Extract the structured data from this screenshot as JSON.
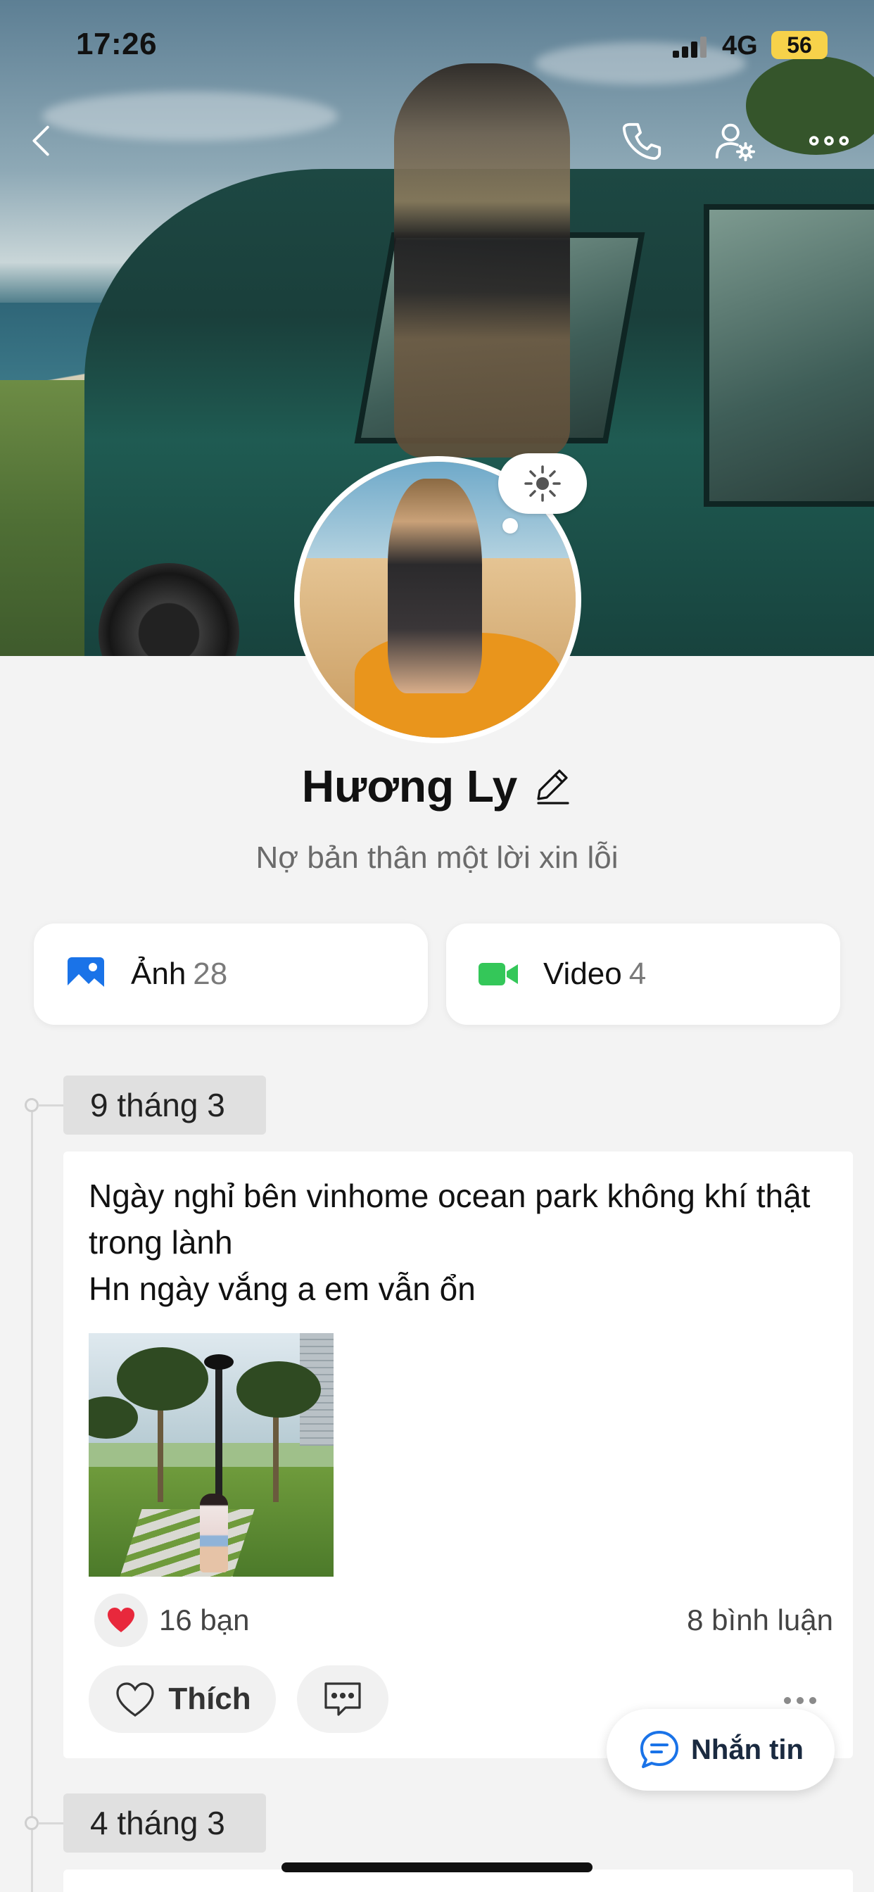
{
  "status_bar": {
    "time": "17:26",
    "network": "4G",
    "battery": "56"
  },
  "nav": {
    "back_icon": "chevron-left-icon",
    "call_icon": "phone-icon",
    "settings_icon": "user-settings-icon",
    "more_icon": "more-horizontal-icon"
  },
  "profile": {
    "name": "Hương Ly",
    "bio": "Nợ bản thân một lời xin lỗi"
  },
  "media": {
    "photos": {
      "label": "Ảnh",
      "count": "28"
    },
    "videos": {
      "label": "Video",
      "count": "4"
    }
  },
  "timeline": [
    {
      "date": "9 tháng 3",
      "text": "Ngày nghỉ bên vinhome ocean park  không khí thật trong lành\nHn ngày vắng a em vẫn ổn",
      "likes": "16 bạn",
      "comments": "8 bình luận",
      "like_label": "Thích"
    },
    {
      "date": "4 tháng 3"
    }
  ],
  "message_button": {
    "label": "Nhắn tin"
  },
  "colors": {
    "photo_icon": "#1a73e8",
    "video_icon": "#34c759",
    "heart": "#e8283c",
    "message_icon": "#1a73e8",
    "battery": "#f7d24a"
  }
}
